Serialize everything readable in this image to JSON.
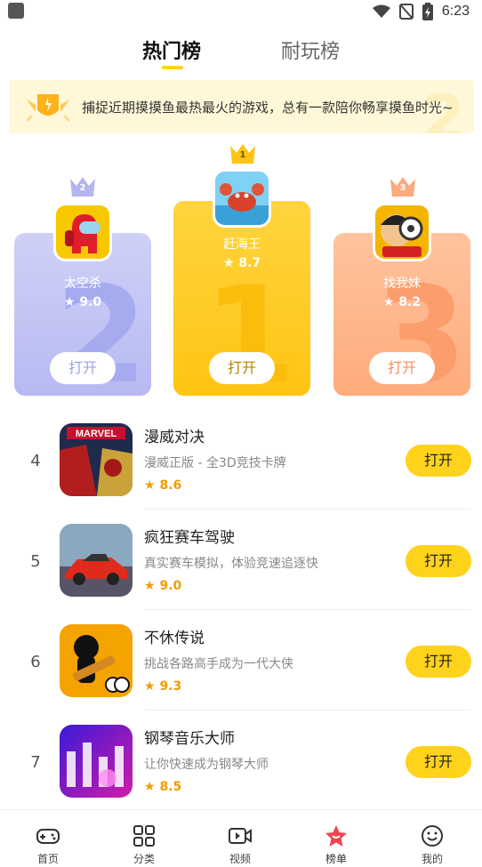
{
  "status_bar": {
    "time": "6:23"
  },
  "tabs": [
    {
      "label": "热门榜",
      "active": true
    },
    {
      "label": "耐玩榜",
      "active": false
    }
  ],
  "banner": {
    "text": "捕捉近期摸摸鱼最热最火的游戏，总有一款陪你畅享摸鱼时光~"
  },
  "podium": [
    {
      "rank": "1",
      "name": "赶海王",
      "rating": "8.7",
      "button": "打开",
      "icon": "crab-game-icon"
    },
    {
      "rank": "2",
      "name": "太空杀",
      "rating": "9.0",
      "button": "打开",
      "icon": "crewmate-icon"
    },
    {
      "rank": "3",
      "name": "找我妹",
      "rating": "8.2",
      "button": "打开",
      "icon": "magnifier-boy-icon"
    }
  ],
  "list": [
    {
      "rank": "4",
      "title": "漫威对决",
      "desc": "漫威正版 - 全3D竞技卡牌",
      "rating": "8.6",
      "button": "打开",
      "icon": "marvel-icon"
    },
    {
      "rank": "5",
      "title": "疯狂赛车驾驶",
      "desc": "真实赛车模拟，体验竞速追逐快",
      "rating": "9.0",
      "button": "打开",
      "icon": "racing-car-icon"
    },
    {
      "rank": "6",
      "title": "不休传说",
      "desc": "挑战各路高手成为一代大侠",
      "rating": "9.3",
      "button": "打开",
      "icon": "stickman-icon"
    },
    {
      "rank": "7",
      "title": "钢琴音乐大师",
      "desc": "让你快速成为钢琴大师",
      "rating": "8.5",
      "button": "打开",
      "icon": "piano-tiles-icon"
    }
  ],
  "bottom_nav": [
    {
      "label": "首页",
      "icon": "gamepad-icon",
      "active": false
    },
    {
      "label": "分类",
      "icon": "grid-icon",
      "active": false
    },
    {
      "label": "视频",
      "icon": "video-icon",
      "active": false
    },
    {
      "label": "榜单",
      "icon": "ranking-star-icon",
      "active": true
    },
    {
      "label": "我的",
      "icon": "smiley-icon",
      "active": false
    }
  ],
  "colors": {
    "accent": "#ffd21c",
    "rating": "#f39b00",
    "rank2": "#b7baf2",
    "rank1": "#ffc414",
    "rank3": "#ffab7c"
  }
}
